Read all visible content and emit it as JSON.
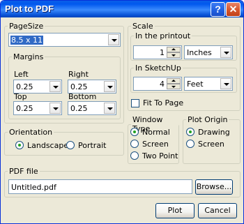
{
  "window": {
    "title": "Plot to PDF",
    "help_symbol": "?",
    "close_symbol": "✕"
  },
  "pagesize": {
    "legend": "PageSize",
    "selected": "8.5 x 11",
    "margins": {
      "legend": "Margins",
      "left_label": "Left",
      "left_value": "0.25",
      "right_label": "Right",
      "right_value": "0.25",
      "top_label": "Top",
      "top_value": "0.25",
      "bottom_label": "Bottom",
      "bottom_value": "0.25"
    }
  },
  "orientation": {
    "legend": "Orientation",
    "landscape": "Landscape",
    "portrait": "Portrait",
    "selected": "landscape"
  },
  "scale": {
    "legend": "Scale",
    "printout": {
      "legend": "In the printout",
      "value": "1",
      "unit": "Inches"
    },
    "sketchup": {
      "legend": "In SketchUp",
      "value": "4",
      "unit": "Feet"
    },
    "fit_to_page": "Fit To Page"
  },
  "window_type": {
    "legend": "Window Type",
    "normal": "Normal",
    "screen": "Screen",
    "two_point": "Two Point",
    "selected": "normal"
  },
  "plot_origin": {
    "legend": "Plot Origin",
    "drawing": "Drawing",
    "screen": "Screen",
    "selected": "drawing"
  },
  "pdf_file": {
    "legend": "PDF file",
    "filename": "Untitled.pdf",
    "browse": "Browse..."
  },
  "actions": {
    "plot": "Plot",
    "cancel": "Cancel"
  }
}
